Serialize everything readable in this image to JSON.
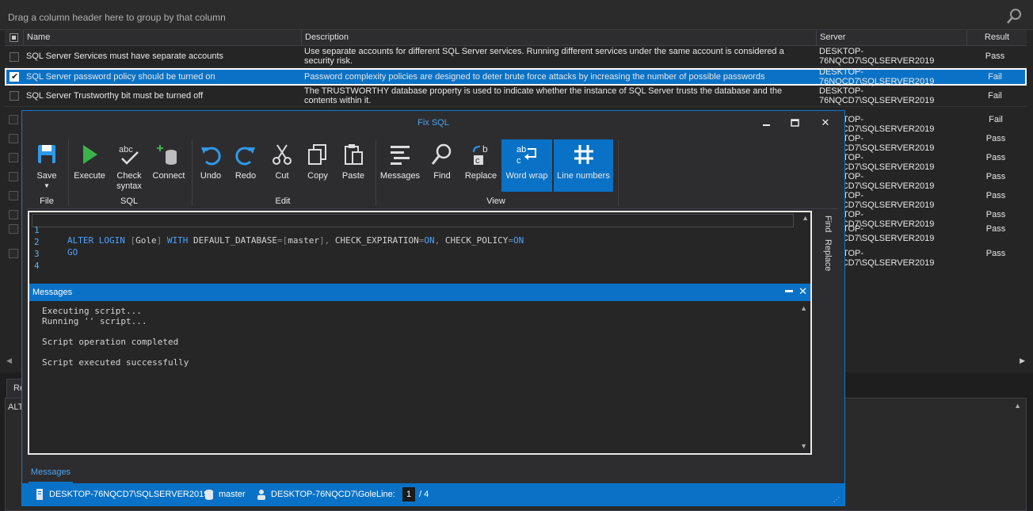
{
  "group_bar": {
    "text": "Drag a column header here to group by that column"
  },
  "grid": {
    "columns": {
      "name": "Name",
      "description": "Description",
      "server": "Server",
      "result": "Result"
    },
    "rows": [
      {
        "name": "SQL Server Services must have separate accounts",
        "description": "Use separate accounts for different SQL Server services. Running different services under the same account is considered a security risk.",
        "server": "DESKTOP-76NQCD7\\SQLSERVER2019",
        "result": "Pass",
        "checked": false
      },
      {
        "name": "SQL Server password policy should be turned on",
        "description": "Password complexity policies are designed to deter brute force attacks by increasing the number of possible passwords",
        "server": "DESKTOP-76NQCD7\\SQLSERVER2019",
        "result": "Fail",
        "checked": true
      },
      {
        "name": "SQL Server Trustworthy bit must be turned off",
        "description": "The TRUSTWORTHY database property is used to indicate whether the instance of SQL Server trusts the database and the contents within it.",
        "server": "DESKTOP-76NQCD7\\SQLSERVER2019",
        "result": "Fail",
        "checked": false
      }
    ],
    "hidden_rows": [
      {
        "server": "DESKTOP-76NQCD7\\SQLSERVER2019",
        "result": "Fail"
      },
      {
        "server": "DESKTOP-76NQCD7\\SQLSERVER2019",
        "result": "Pass"
      },
      {
        "server": "DESKTOP-76NQCD7\\SQLSERVER2019",
        "result": "Pass"
      },
      {
        "server": "DESKTOP-76NQCD7\\SQLSERVER2019",
        "result": "Pass"
      },
      {
        "server": "DESKTOP-76NQCD7\\SQLSERVER2019",
        "result": "Pass"
      },
      {
        "server": "DESKTOP-76NQCD7\\SQLSERVER2019",
        "result": "Pass"
      },
      {
        "server": "DESKTOP-76NQCD7\\SQLSERVER2019",
        "result": "Pass"
      },
      {
        "server": "DESKTOP-76NQCD7\\SQLSERVER2019",
        "result": "Pass"
      }
    ]
  },
  "bottom": {
    "tab_label": "Re",
    "text": "ALT"
  },
  "dialog": {
    "title": "Fix SQL",
    "ribbon": {
      "groups": {
        "file": "File",
        "sql": "SQL",
        "edit": "Edit",
        "view": "View"
      },
      "buttons": {
        "save": "Save",
        "execute": "Execute",
        "check_syntax": "Check syntax",
        "connect": "Connect",
        "undo": "Undo",
        "redo": "Redo",
        "cut": "Cut",
        "copy": "Copy",
        "paste": "Paste",
        "messages": "Messages",
        "find": "Find",
        "replace": "Replace",
        "word_wrap": "Word wrap",
        "line_numbers": "Line numbers"
      },
      "active": [
        "word_wrap",
        "line_numbers"
      ]
    },
    "editor": {
      "line_numbers": [
        "1",
        "2",
        "3",
        "4"
      ],
      "line1": {
        "kw1": "ALTER LOGIN ",
        "b1": "[",
        "login": "Gole",
        "b2": "]",
        "kw2": " WITH ",
        "t1": "DEFAULT_DATABASE",
        "eq1": "=",
        "b3": "[",
        "db": "master",
        "b4": "]",
        "comma1": ", ",
        "t2": "CHECK_EXPIRATION",
        "eq2": "=",
        "on1": "ON",
        "comma2": ", ",
        "t3": "CHECK_POLICY",
        "eq3": "=",
        "on2": "ON"
      },
      "line2": "GO"
    },
    "side_tabs": {
      "find": "Find",
      "replace": "Replace"
    },
    "messages_panel": {
      "title": "Messages",
      "lines": [
        "Executing script...",
        "Running '' script...",
        "",
        "Script operation completed",
        "",
        "Script executed successfully"
      ]
    },
    "bottom_tab": "Messages",
    "status": {
      "server": "DESKTOP-76NQCD7\\SQLSERVER2019",
      "database": "master",
      "user": "DESKTOP-76NQCD7\\Gole",
      "line_label": "Line:",
      "line_value": "1",
      "line_total": "/ 4"
    }
  },
  "colors": {
    "accent": "#0a72c6",
    "keyword": "#4da3ff",
    "title": "#4ca3ec"
  }
}
